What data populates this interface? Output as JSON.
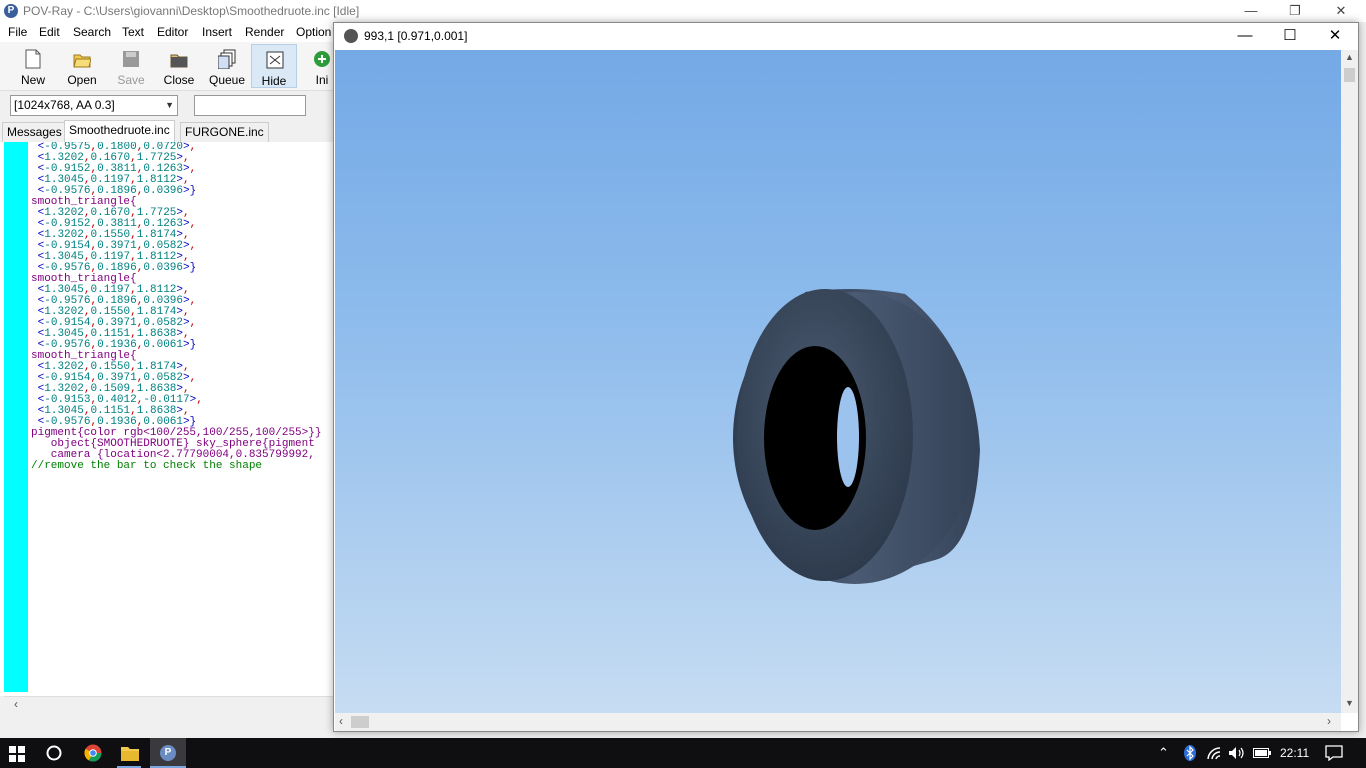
{
  "main_window": {
    "title": "POV-Ray - C:\\Users\\giovanni\\Desktop\\Smoothedruote.inc [Idle]",
    "menu": [
      "File",
      "Edit",
      "Search",
      "Text",
      "Editor",
      "Insert",
      "Render",
      "Option"
    ],
    "toolbar": [
      {
        "label": "New",
        "icon": "new-file-icon",
        "enabled": true
      },
      {
        "label": "Open",
        "icon": "open-folder-icon",
        "enabled": true
      },
      {
        "label": "Save",
        "icon": "save-icon",
        "enabled": false
      },
      {
        "label": "Close",
        "icon": "close-file-icon",
        "enabled": true
      },
      {
        "label": "Queue",
        "icon": "queue-icon",
        "enabled": true
      },
      {
        "label": "Hide",
        "icon": "hide-icon",
        "enabled": true,
        "active": true
      },
      {
        "label": "Ini",
        "icon": "ini-icon",
        "enabled": true
      }
    ],
    "resolution_select": "[1024x768, AA 0.3]",
    "command_input": "",
    "tabs": [
      "Messages",
      "Smoothedruote.inc",
      "FURGONE.inc"
    ],
    "active_tab": "Smoothedruote.inc"
  },
  "code_lines": [
    {
      "text": " <-0.9575,0.1800,0.0720>,",
      "kind": "vec"
    },
    {
      "text": " <1.3202,0.1670,1.7725>,",
      "kind": "vec"
    },
    {
      "text": " <-0.9152,0.3811,0.1263>,",
      "kind": "vec"
    },
    {
      "text": " <1.3045,0.1197,1.8112>,",
      "kind": "vec"
    },
    {
      "text": " <-0.9576,0.1896,0.0396>}",
      "kind": "vec"
    },
    {
      "text": "smooth_triangle{",
      "kind": "kw"
    },
    {
      "text": " <1.3202,0.1670,1.7725>,",
      "kind": "vec"
    },
    {
      "text": " <-0.9152,0.3811,0.1263>,",
      "kind": "vec"
    },
    {
      "text": " <1.3202,0.1550,1.8174>,",
      "kind": "vec"
    },
    {
      "text": " <-0.9154,0.3971,0.0582>,",
      "kind": "vec"
    },
    {
      "text": " <1.3045,0.1197,1.8112>,",
      "kind": "vec"
    },
    {
      "text": " <-0.9576,0.1896,0.0396>}",
      "kind": "vec"
    },
    {
      "text": "smooth_triangle{",
      "kind": "kw"
    },
    {
      "text": " <1.3045,0.1197,1.8112>,",
      "kind": "vec"
    },
    {
      "text": " <-0.9576,0.1896,0.0396>,",
      "kind": "vec"
    },
    {
      "text": " <1.3202,0.1550,1.8174>,",
      "kind": "vec"
    },
    {
      "text": " <-0.9154,0.3971,0.0582>,",
      "kind": "vec"
    },
    {
      "text": " <1.3045,0.1151,1.8638>,",
      "kind": "vec"
    },
    {
      "text": " <-0.9576,0.1936,0.0061>}",
      "kind": "vec"
    },
    {
      "text": "smooth_triangle{",
      "kind": "kw"
    },
    {
      "text": " <1.3202,0.1550,1.8174>,",
      "kind": "vec"
    },
    {
      "text": " <-0.9154,0.3971,0.0582>,",
      "kind": "vec"
    },
    {
      "text": " <1.3202,0.1509,1.8638>,",
      "kind": "vec"
    },
    {
      "text": " <-0.9153,0.4012,-0.0117>,",
      "kind": "vec"
    },
    {
      "text": " <1.3045,0.1151,1.8638>,",
      "kind": "vec"
    },
    {
      "text": " <-0.9576,0.1936,0.0061>}",
      "kind": "vec"
    },
    {
      "text": "pigment{color rgb<100/255,100/255,100/255>}}",
      "kind": "kw"
    },
    {
      "text": "   object{SMOOTHEDRUOTE} sky_sphere{pigment",
      "kind": "obj"
    },
    {
      "text": "   camera {location<2.77790004,0.835799992,",
      "kind": "cam"
    },
    {
      "text": "//remove the bar to check the shape",
      "kind": "comment"
    }
  ],
  "render_window": {
    "title": "993,1 [0.971,0.001]",
    "icon": "povray-render-icon"
  },
  "colors": {
    "sky_top": "#74a9e6",
    "sky_bottom": "#c6dcf2",
    "tire": "#3a4a5f",
    "gutter": "#00ffff",
    "taskbar": "#0f0f12"
  },
  "taskbar": {
    "apps": [
      "windows-start-icon",
      "cortana-icon",
      "chrome-icon",
      "file-explorer-icon",
      "povray-icon"
    ],
    "tray_icons": [
      "chevron-up-icon",
      "bluetooth-icon",
      "network-icon",
      "volume-icon",
      "battery-icon"
    ],
    "time": "22:11",
    "notification_icon": "notification-icon"
  }
}
